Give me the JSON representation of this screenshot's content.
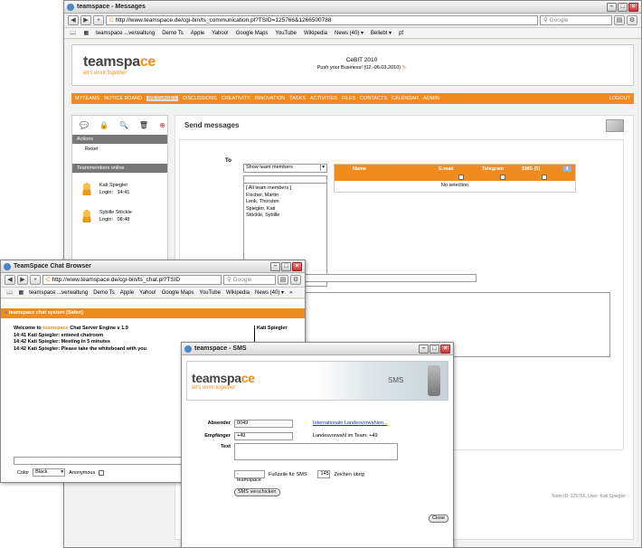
{
  "main_window": {
    "title": "teamspace - Messages",
    "url": "http://www.teamspace.de/cgi-bin/ts_communication.pl?TSID=125766&1266500788",
    "search_placeholder": "Google",
    "bookmarks": [
      "teamspace ...verwaltung",
      "Demo Ts",
      "Apple",
      "Yahoo!",
      "Google Maps",
      "YouTube",
      "Wikipedia",
      "News (40) ▾",
      "Beliebt ▾",
      "pf"
    ],
    "logo_text": "teamspa",
    "logo_ce": "ce",
    "tagline": "let's work together",
    "cebit_title": "CeBIT 2010",
    "cebit_sub": "Push your Business! (02.-06.03.2010)",
    "nav": [
      "MYTEAMS",
      "NOTICE BOARD",
      "MESSAGES",
      "DISCUSSIONS",
      "CREATIVITY",
      "INNOVATION",
      "TASKS",
      "ACTIVITIES",
      "FILES",
      "CONTACTS",
      "CALENDAR",
      "ADMIN"
    ],
    "logout": "LOGOUT",
    "actions_header": "Actions",
    "reset_label": "Reset",
    "members_header": "Teammembers online",
    "members": [
      {
        "name": "Kati Spiegler",
        "login_label": "Login:",
        "time": "14:41"
      },
      {
        "name": "Sybille Stöckle",
        "login_label": "Login:",
        "time": "08:48"
      }
    ],
    "page_title": "Send messages",
    "to_label": "To",
    "select_value": "Show team members",
    "member_list": [
      "[ All team members ]",
      "Fischer, Martin",
      "Lenk, Thorsten",
      "Spiegler, Kati",
      "Stöckle, Sybille"
    ],
    "grid_cols": [
      "Name",
      "E-mail",
      "Telegram",
      "SMS (5)"
    ],
    "no_selection": "No selection",
    "footer": "Team ID: 125766, User: Kati Spiegler",
    "colors": {
      "accent": "#f08c1e",
      "gray": "#777777"
    }
  },
  "chat_window": {
    "title": "TeamSpace Chat Browser",
    "url": "http://www.teamspace.de/cgi-bin/ts_chat.pl?TSID",
    "search_placeholder": "Google",
    "bookmarks": [
      "teamspace ...verwaltung",
      "Demo Ts",
      "Apple",
      "Yahoo!",
      "Google Maps",
      "YouTube",
      "Wikipedia",
      "News (40) ▾"
    ],
    "bar_title": "teamspace chat system (Safari)",
    "welcome_pre": "Welcome to",
    "welcome_brand": "teamspace",
    "welcome_post": "Chat Server Engine v 1.9",
    "lines": [
      "14:41 Kati Spiegler: entered chatroom",
      "14:42 Kati Spiegler: Meeting in 5 minutes",
      "14:42 Kati Spiegler: Please take the whiteboard with you"
    ],
    "user": "Kati Spiegler",
    "color_label": "Color",
    "color_value": "Black",
    "anonymous_label": "Anonymous"
  },
  "sms_window": {
    "title": "teamspace - SMS",
    "logo_text": "teamspa",
    "logo_ce": "ce",
    "tagline": "let's work together",
    "banner_label": "SMS",
    "sender_label": "Absender",
    "sender_value": "0049",
    "intl_link": "Internationale Landesvorwahlen...",
    "recipient_label": "Empfänger",
    "recipient_value": "+49",
    "country_code_text": "Landesvorwahl im Team: +49",
    "text_label": "Text",
    "footer_sig": "- teamspace",
    "footer_label": "Fußzeile für SMS",
    "chars_left": "145",
    "chars_label": "Zeichen übrig",
    "send_button": "SMS verschicken",
    "close_button": "Close"
  }
}
